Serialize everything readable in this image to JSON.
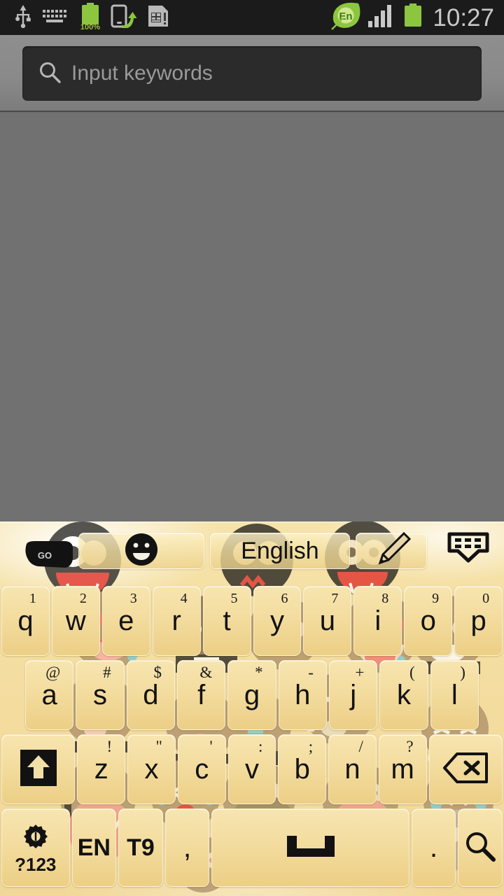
{
  "statusbar": {
    "icons_left": [
      "usb-icon",
      "keyboard-icon",
      "battery-charging-icon",
      "usb-transfer-icon",
      "sim-card-icon"
    ],
    "battery_percent": "100%",
    "icons_right": [
      "go-keyboard-en-icon",
      "signal-bars-icon",
      "battery-icon"
    ],
    "input_method_label": "En",
    "clock": "10:27",
    "clock_color": "#c8c8c8",
    "background": "#1b1b1b",
    "battery_color": "#8cc63e"
  },
  "search": {
    "placeholder": "Input keywords",
    "value": "",
    "icon": "search-icon",
    "field_bg": "#2b2b2b",
    "header_bg": "#8a8a8a"
  },
  "content": {
    "background": "#717171"
  },
  "keyboard": {
    "theme_bg_start": "#f6e3a9",
    "theme_bg_end": "#f2d898",
    "key_face_top": "#f7e5b0",
    "key_face_bottom": "#eccf86",
    "toolbar": {
      "go_logo_label": "GO",
      "buttons": [
        {
          "name": "emoji-button",
          "icon": "smiley-face-icon",
          "label": ""
        },
        {
          "name": "language-button",
          "icon": "",
          "label": "English"
        },
        {
          "name": "handwriting-button",
          "icon": "pencil-icon",
          "label": ""
        },
        {
          "name": "hide-keyboard-button",
          "icon": "keyboard-down-icon",
          "label": ""
        }
      ]
    },
    "rows": [
      {
        "name": "qwerty-row",
        "keys": [
          {
            "main": "q",
            "sup": "1"
          },
          {
            "main": "w",
            "sup": "2"
          },
          {
            "main": "e",
            "sup": "3"
          },
          {
            "main": "r",
            "sup": "4"
          },
          {
            "main": "t",
            "sup": "5"
          },
          {
            "main": "y",
            "sup": "6"
          },
          {
            "main": "u",
            "sup": "7"
          },
          {
            "main": "i",
            "sup": "8"
          },
          {
            "main": "o",
            "sup": "9"
          },
          {
            "main": "p",
            "sup": "0"
          }
        ]
      },
      {
        "name": "asdf-row",
        "keys": [
          {
            "main": "a",
            "sup": "@"
          },
          {
            "main": "s",
            "sup": "#"
          },
          {
            "main": "d",
            "sup": "$"
          },
          {
            "main": "f",
            "sup": "&"
          },
          {
            "main": "g",
            "sup": "*"
          },
          {
            "main": "h",
            "sup": "-"
          },
          {
            "main": "j",
            "sup": "+"
          },
          {
            "main": "k",
            "sup": "("
          },
          {
            "main": "l",
            "sup": ")"
          }
        ]
      },
      {
        "name": "zxcv-row",
        "keys": [
          {
            "main": "",
            "sup": "",
            "icon": "shift-icon",
            "wide": true
          },
          {
            "main": "z",
            "sup": "!"
          },
          {
            "main": "x",
            "sup": "\""
          },
          {
            "main": "c",
            "sup": "'"
          },
          {
            "main": "v",
            "sup": ":"
          },
          {
            "main": "b",
            "sup": ";"
          },
          {
            "main": "n",
            "sup": "/"
          },
          {
            "main": "m",
            "sup": "?"
          },
          {
            "main": "",
            "sup": "",
            "icon": "backspace-icon",
            "wide": true
          }
        ]
      },
      {
        "name": "bottom-row",
        "keys": [
          {
            "main": "?123",
            "sup": "",
            "icon": "gear-icon",
            "wide": true
          },
          {
            "main": "EN",
            "sup": ""
          },
          {
            "main": "T9",
            "sup": ""
          },
          {
            "main": ",",
            "sup": ""
          },
          {
            "main": "",
            "sup": "",
            "icon": "space-icon",
            "space": true
          },
          {
            "main": ".",
            "sup": ""
          },
          {
            "main": "",
            "sup": "",
            "icon": "search-icon"
          }
        ]
      }
    ]
  }
}
